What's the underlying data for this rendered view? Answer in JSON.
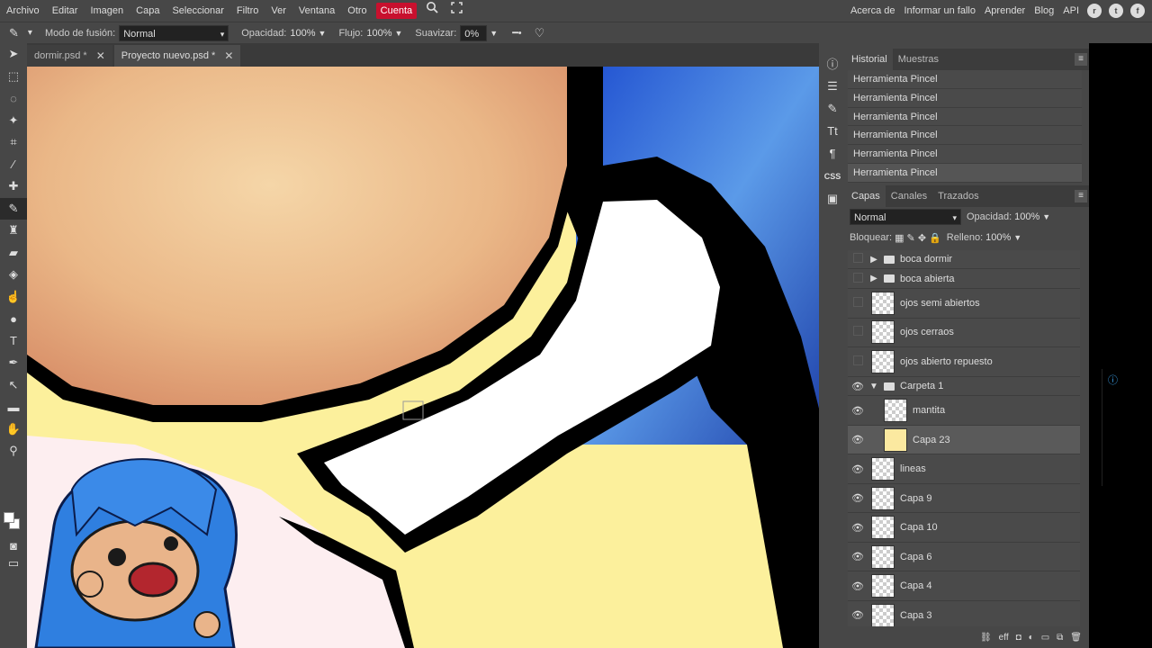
{
  "menu": {
    "items": [
      "Archivo",
      "Editar",
      "Imagen",
      "Capa",
      "Seleccionar",
      "Filtro",
      "Ver",
      "Ventana",
      "Otro"
    ],
    "highlight": "Cuenta",
    "right_items": [
      "Acerca de",
      "Informar un fallo",
      "Aprender",
      "Blog",
      "API"
    ]
  },
  "options": {
    "blend_label": "Modo de fusión:",
    "blend_value": "Normal",
    "opacity_label": "Opacidad:",
    "opacity_value": "100%",
    "flow_label": "Flujo:",
    "flow_value": "100%",
    "smooth_label": "Suavizar:",
    "smooth_value": "0%"
  },
  "tabs": [
    {
      "label": "dormir.psd *",
      "active": false
    },
    {
      "label": "Proyecto nuevo.psd *",
      "active": true
    }
  ],
  "history": {
    "tabs": [
      "Historial",
      "Muestras"
    ],
    "items": [
      "Herramienta Pincel",
      "Herramienta Pincel",
      "Herramienta Pincel",
      "Herramienta Pincel",
      "Herramienta Pincel",
      "Herramienta Pincel"
    ]
  },
  "layers": {
    "tabs": [
      "Capas",
      "Canales",
      "Trazados"
    ],
    "blend": "Normal",
    "opacity_label": "Opacidad:",
    "opacity_value": "100%",
    "lock_label": "Bloquear:",
    "fill_label": "Relleno:",
    "fill_value": "100%",
    "list": [
      {
        "name": "boca dormir",
        "type": "folder",
        "visible": false
      },
      {
        "name": "boca abierta",
        "type": "folder",
        "visible": false
      },
      {
        "name": "ojos semi abiertos",
        "type": "layer",
        "visible": false
      },
      {
        "name": "ojos cerraos",
        "type": "layer",
        "visible": false
      },
      {
        "name": "ojos abierto repuesto",
        "type": "layer",
        "visible": false
      },
      {
        "name": "Carpeta 1",
        "type": "folder-open",
        "visible": true
      },
      {
        "name": "mantita",
        "type": "layer",
        "visible": true
      },
      {
        "name": "Capa 23",
        "type": "layer",
        "visible": true
      },
      {
        "name": "lineas",
        "type": "layer",
        "visible": true
      },
      {
        "name": "Capa 9",
        "type": "layer",
        "visible": true
      },
      {
        "name": "Capa 10",
        "type": "layer",
        "visible": true
      },
      {
        "name": "Capa 6",
        "type": "layer",
        "visible": true
      },
      {
        "name": "Capa 4",
        "type": "layer",
        "visible": true
      },
      {
        "name": "Capa 3",
        "type": "layer",
        "visible": true
      }
    ]
  },
  "colors": {
    "accent": "#c8102e",
    "panel": "#474747",
    "skin": "#f2c49a",
    "hair": "#2a6fd6",
    "blanket": "#fcf09c"
  }
}
